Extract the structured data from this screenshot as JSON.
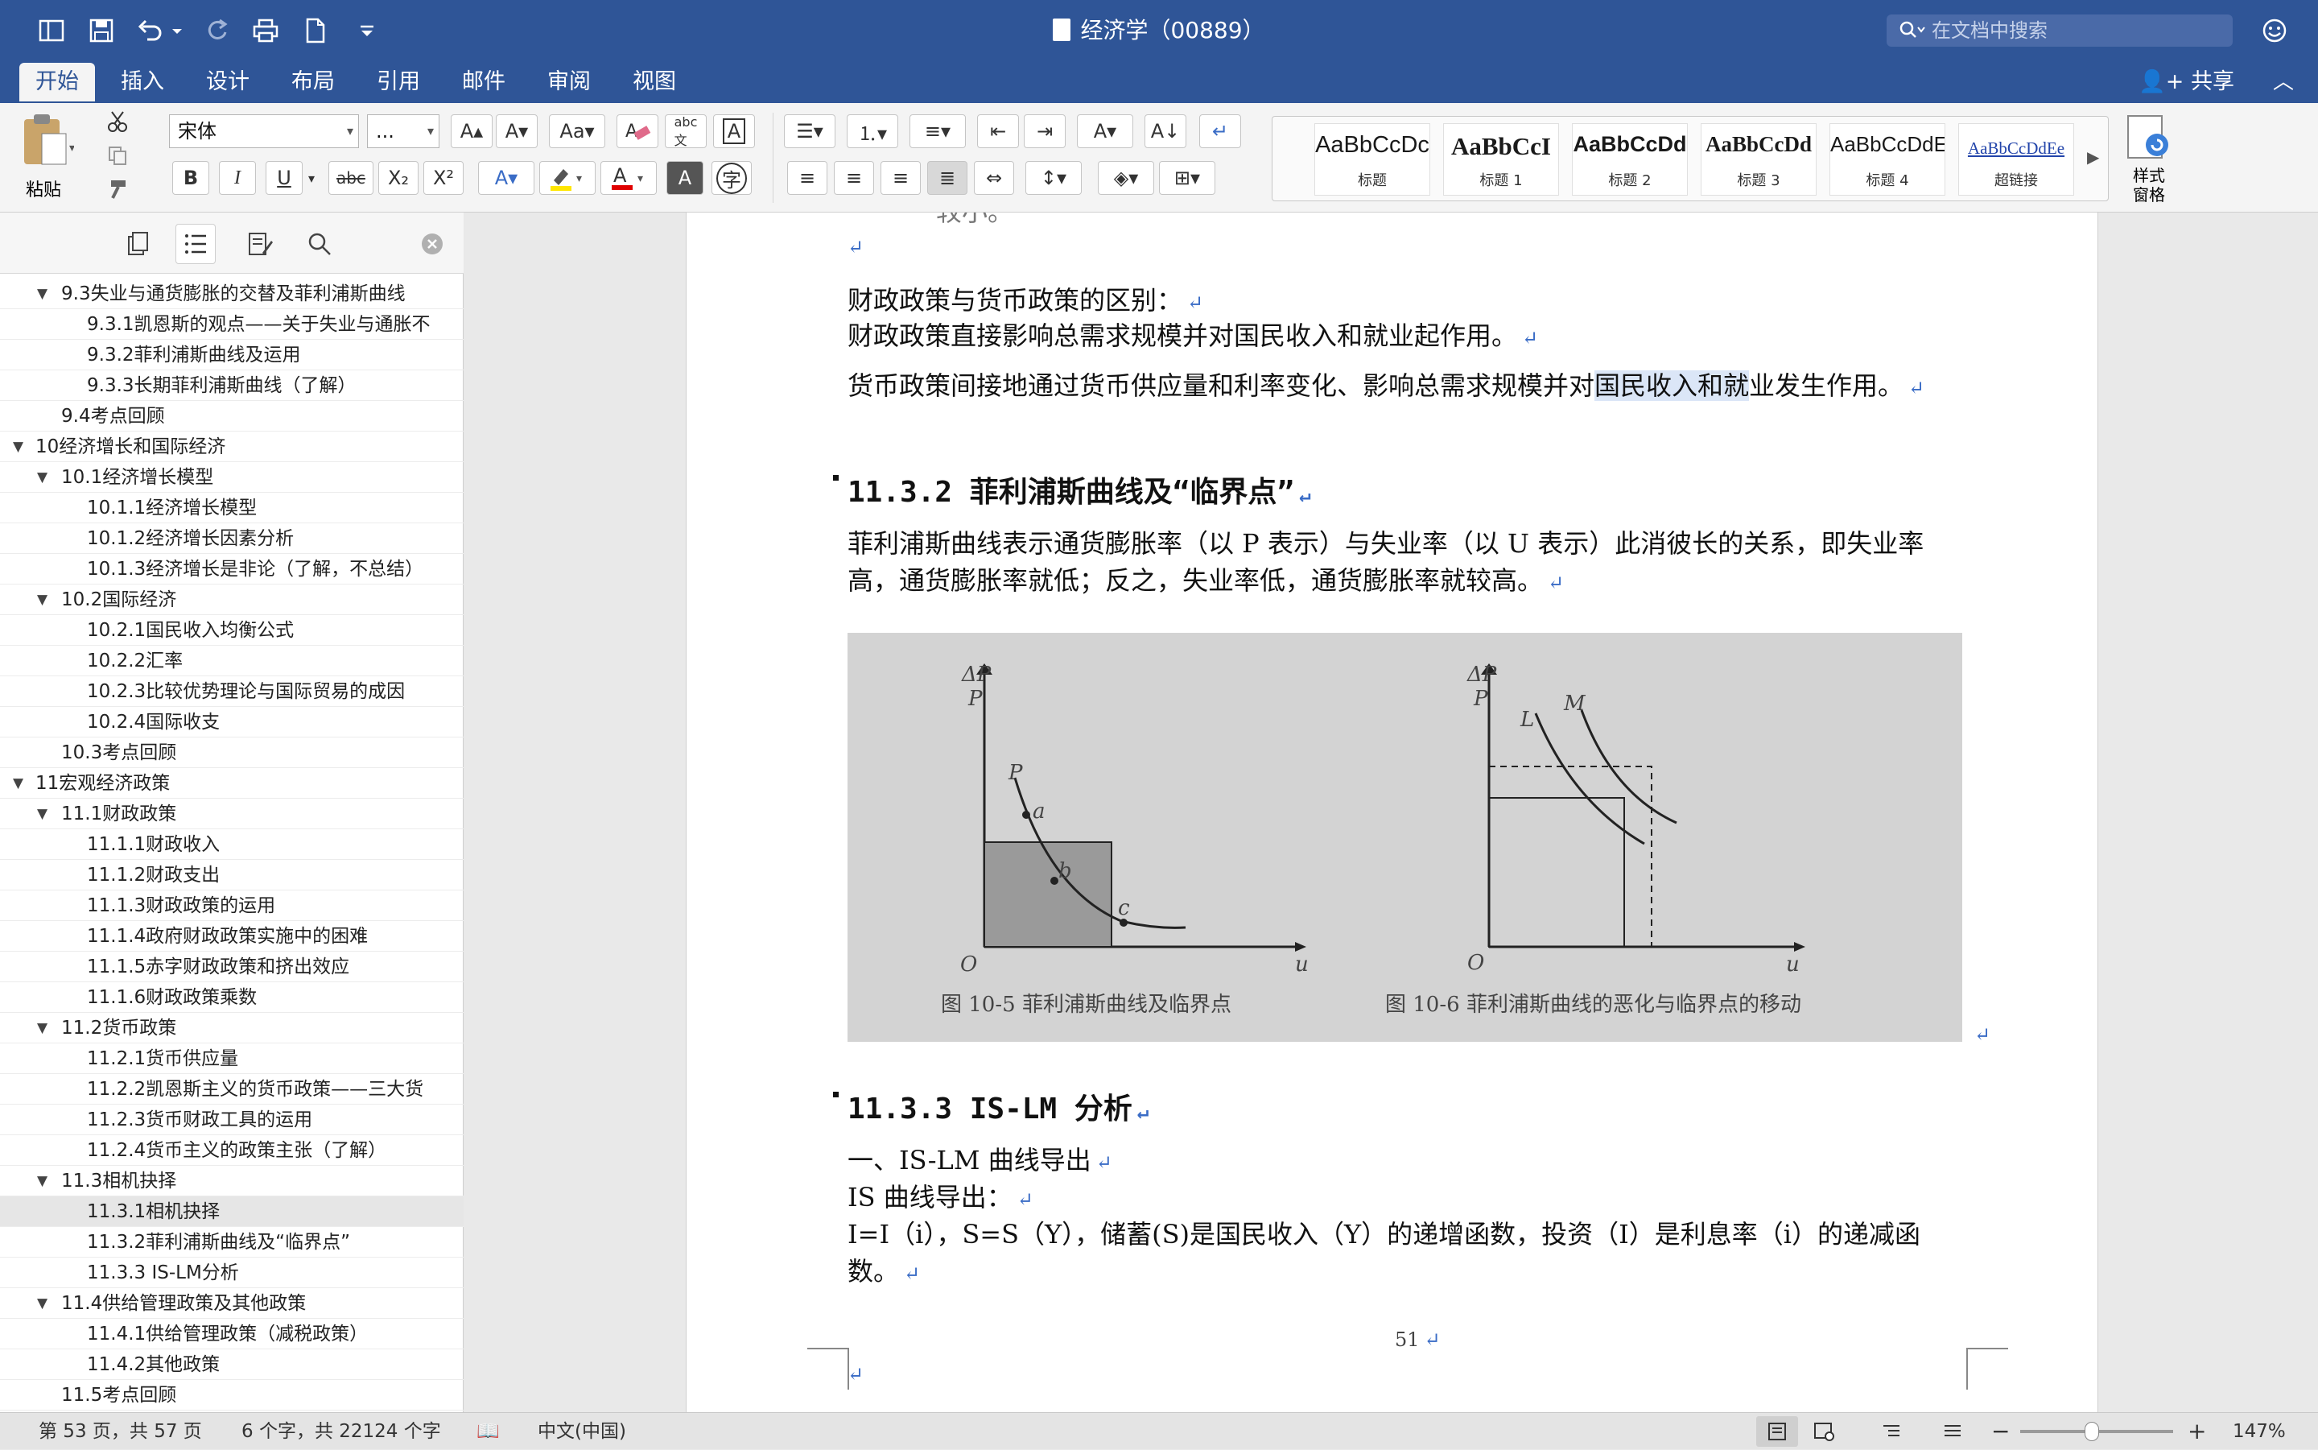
{
  "window": {
    "title": "经济学（00889）",
    "search_placeholder": "在文档中搜索"
  },
  "tabs": [
    "开始",
    "插入",
    "设计",
    "布局",
    "引用",
    "邮件",
    "审阅",
    "视图"
  ],
  "share_label": "共享",
  "ribbon": {
    "paste_label": "粘贴",
    "font_name": "宋体",
    "font_size": "...",
    "bold": "B",
    "italic": "I",
    "underline": "U",
    "strike": "abc",
    "subscript": "X₂",
    "superscript": "X²",
    "styles": [
      {
        "preview": "AaBbCcDc",
        "name": "标题"
      },
      {
        "preview": "AaBbCcI",
        "name": "标题 1"
      },
      {
        "preview": "AaBbCcDd",
        "name": "标题 2"
      },
      {
        "preview": "AaBbCcDd",
        "name": "标题 3"
      },
      {
        "preview": "AaBbCcDdE",
        "name": "标题 4"
      },
      {
        "preview": "AaBbCcDdEe",
        "name": "超链接"
      }
    ],
    "styles_pane_label": "样式\n窗格"
  },
  "nav": {
    "items": [
      {
        "label": "9.3失业与通货膨胀的交替及菲利浦斯曲线",
        "level": 2,
        "toggle": "▼"
      },
      {
        "label": "9.3.1凯恩斯的观点——关于失业与通胀不",
        "level": 3
      },
      {
        "label": "9.3.2菲利浦斯曲线及运用",
        "level": 3
      },
      {
        "label": "9.3.3长期菲利浦斯曲线（了解）",
        "level": 3
      },
      {
        "label": "9.4考点回顾",
        "level": 2
      },
      {
        "label": "10经济增长和国际经济",
        "level": 1,
        "toggle": "▼"
      },
      {
        "label": "10.1经济增长模型",
        "level": 2,
        "toggle": "▼"
      },
      {
        "label": "10.1.1经济增长模型",
        "level": 3
      },
      {
        "label": "10.1.2经济增长因素分析",
        "level": 3
      },
      {
        "label": "10.1.3经济增长是非论（了解，不总结）",
        "level": 3
      },
      {
        "label": "10.2国际经济",
        "level": 2,
        "toggle": "▼"
      },
      {
        "label": "10.2.1国民收入均衡公式",
        "level": 3
      },
      {
        "label": "10.2.2汇率",
        "level": 3
      },
      {
        "label": "10.2.3比较优势理论与国际贸易的成因",
        "level": 3
      },
      {
        "label": "10.2.4国际收支",
        "level": 3
      },
      {
        "label": "10.3考点回顾",
        "level": 2
      },
      {
        "label": "11宏观经济政策",
        "level": 1,
        "toggle": "▼"
      },
      {
        "label": "11.1财政政策",
        "level": 2,
        "toggle": "▼"
      },
      {
        "label": "11.1.1财政收入",
        "level": 3
      },
      {
        "label": "11.1.2财政支出",
        "level": 3
      },
      {
        "label": "11.1.3财政政策的运用",
        "level": 3
      },
      {
        "label": "11.1.4政府财政政策实施中的困难",
        "level": 3
      },
      {
        "label": "11.1.5赤字财政政策和挤出效应",
        "level": 3
      },
      {
        "label": "11.1.6财政政策乘数",
        "level": 3
      },
      {
        "label": "11.2货币政策",
        "level": 2,
        "toggle": "▼"
      },
      {
        "label": "11.2.1货币供应量",
        "level": 3
      },
      {
        "label": "11.2.2凯恩斯主义的货币政策——三大货",
        "level": 3
      },
      {
        "label": "11.2.3货币财政工具的运用",
        "level": 3
      },
      {
        "label": "11.2.4货币主义的政策主张（了解）",
        "level": 3
      },
      {
        "label": "11.3相机抉择",
        "level": 2,
        "toggle": "▼"
      },
      {
        "label": "11.3.1相机抉择",
        "level": 3,
        "selected": true
      },
      {
        "label": "11.3.2菲利浦斯曲线及“临界点”",
        "level": 3
      },
      {
        "label": "11.3.3 IS-LM分析",
        "level": 3
      },
      {
        "label": "11.4供给管理政策及其他政策",
        "level": 2,
        "toggle": "▼"
      },
      {
        "label": "11.4.1供给管理政策（减税政策）",
        "level": 3
      },
      {
        "label": "11.4.2其他政策",
        "level": 3
      },
      {
        "label": "11.5考点回顾",
        "level": 2
      }
    ]
  },
  "doc": {
    "top_fragment": "较小。",
    "p1": "财政政策与货币政策的区别：",
    "p2": "财政政策直接影响总需求规模并对国民收入和就业起作用。",
    "p3a": "货币政策间接地通过货币供应量和利率变化、影响总需求规模并对",
    "p3hl": "国民收入和就",
    "p3b": "业发生作用。",
    "h1": "11.3.2 菲利浦斯曲线及“临界点”",
    "p4": "菲利浦斯曲线表示通货膨胀率（以 P 表示）与失业率（以 U 表示）此消彼长的关系，即失业率高，通货膨胀率就低；反之，失业率低，通货膨胀率就较高。",
    "h2": "11.3.3  IS-LM 分析",
    "p5": "一、IS-LM 曲线导出",
    "p6": "IS 曲线导出：",
    "p7": "I=I（i），S=S（Y），储蓄(S)是国民收入（Y）的递增函数，投资（I）是利息率（i）的递减函数。",
    "page_number": "51",
    "figure": {
      "fig1_caption": "图 10-5    菲利浦斯曲线及临界点",
      "fig2_caption": "图 10-6    菲利浦斯曲线的恶化与临界点的移动",
      "y_label_top": "ΔP",
      "y_label_bottom": "P",
      "x_label": "u",
      "origin": "O",
      "fig1_labels": [
        "P",
        "a",
        "b",
        "c"
      ],
      "fig2_labels": [
        "L",
        "M"
      ]
    }
  },
  "status": {
    "page": "第 53 页，共 57 页",
    "words": "6 个字，共 22124 个字",
    "language": "中文(中国)",
    "zoom": "147%",
    "zoom_fraction": 0.47
  },
  "colors": {
    "titlebar": "#2f5597",
    "ribbon": "#f4f4f4",
    "highlight": "#dbe6f7",
    "para_mark": "#3a6cc6"
  }
}
